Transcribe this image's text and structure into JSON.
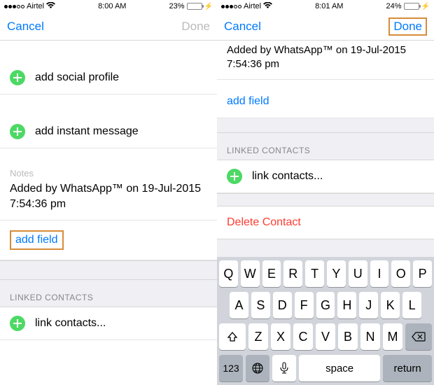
{
  "left": {
    "status": {
      "carrier": "Airtel",
      "time": "8:00 AM",
      "battery_pct": "23%"
    },
    "nav": {
      "cancel": "Cancel",
      "done": "Done"
    },
    "rows": {
      "add_social": "add social profile",
      "add_im": "add instant message"
    },
    "notes": {
      "label": "Notes",
      "text": "Added by WhatsApp™ on 19-Jul-2015 7:54:36 pm"
    },
    "add_field": "add field",
    "linked_header": "LINKED CONTACTS",
    "link_contacts": "link contacts..."
  },
  "right": {
    "status": {
      "carrier": "Airtel",
      "time": "8:01 AM",
      "battery_pct": "24%"
    },
    "nav": {
      "cancel": "Cancel",
      "done": "Done"
    },
    "notes_cut": "Added by WhatsApp™ on 19-Jul-2015 7:54:36 pm",
    "add_field": "add field",
    "linked_header": "LINKED CONTACTS",
    "link_contacts": "link contacts...",
    "delete": "Delete Contact",
    "keyboard": {
      "r1": [
        "Q",
        "W",
        "E",
        "R",
        "T",
        "Y",
        "U",
        "I",
        "O",
        "P"
      ],
      "r2": [
        "A",
        "S",
        "D",
        "F",
        "G",
        "H",
        "J",
        "K",
        "L"
      ],
      "r3": [
        "Z",
        "X",
        "C",
        "V",
        "B",
        "N",
        "M"
      ],
      "k123": "123",
      "space": "space",
      "return": "return"
    }
  }
}
